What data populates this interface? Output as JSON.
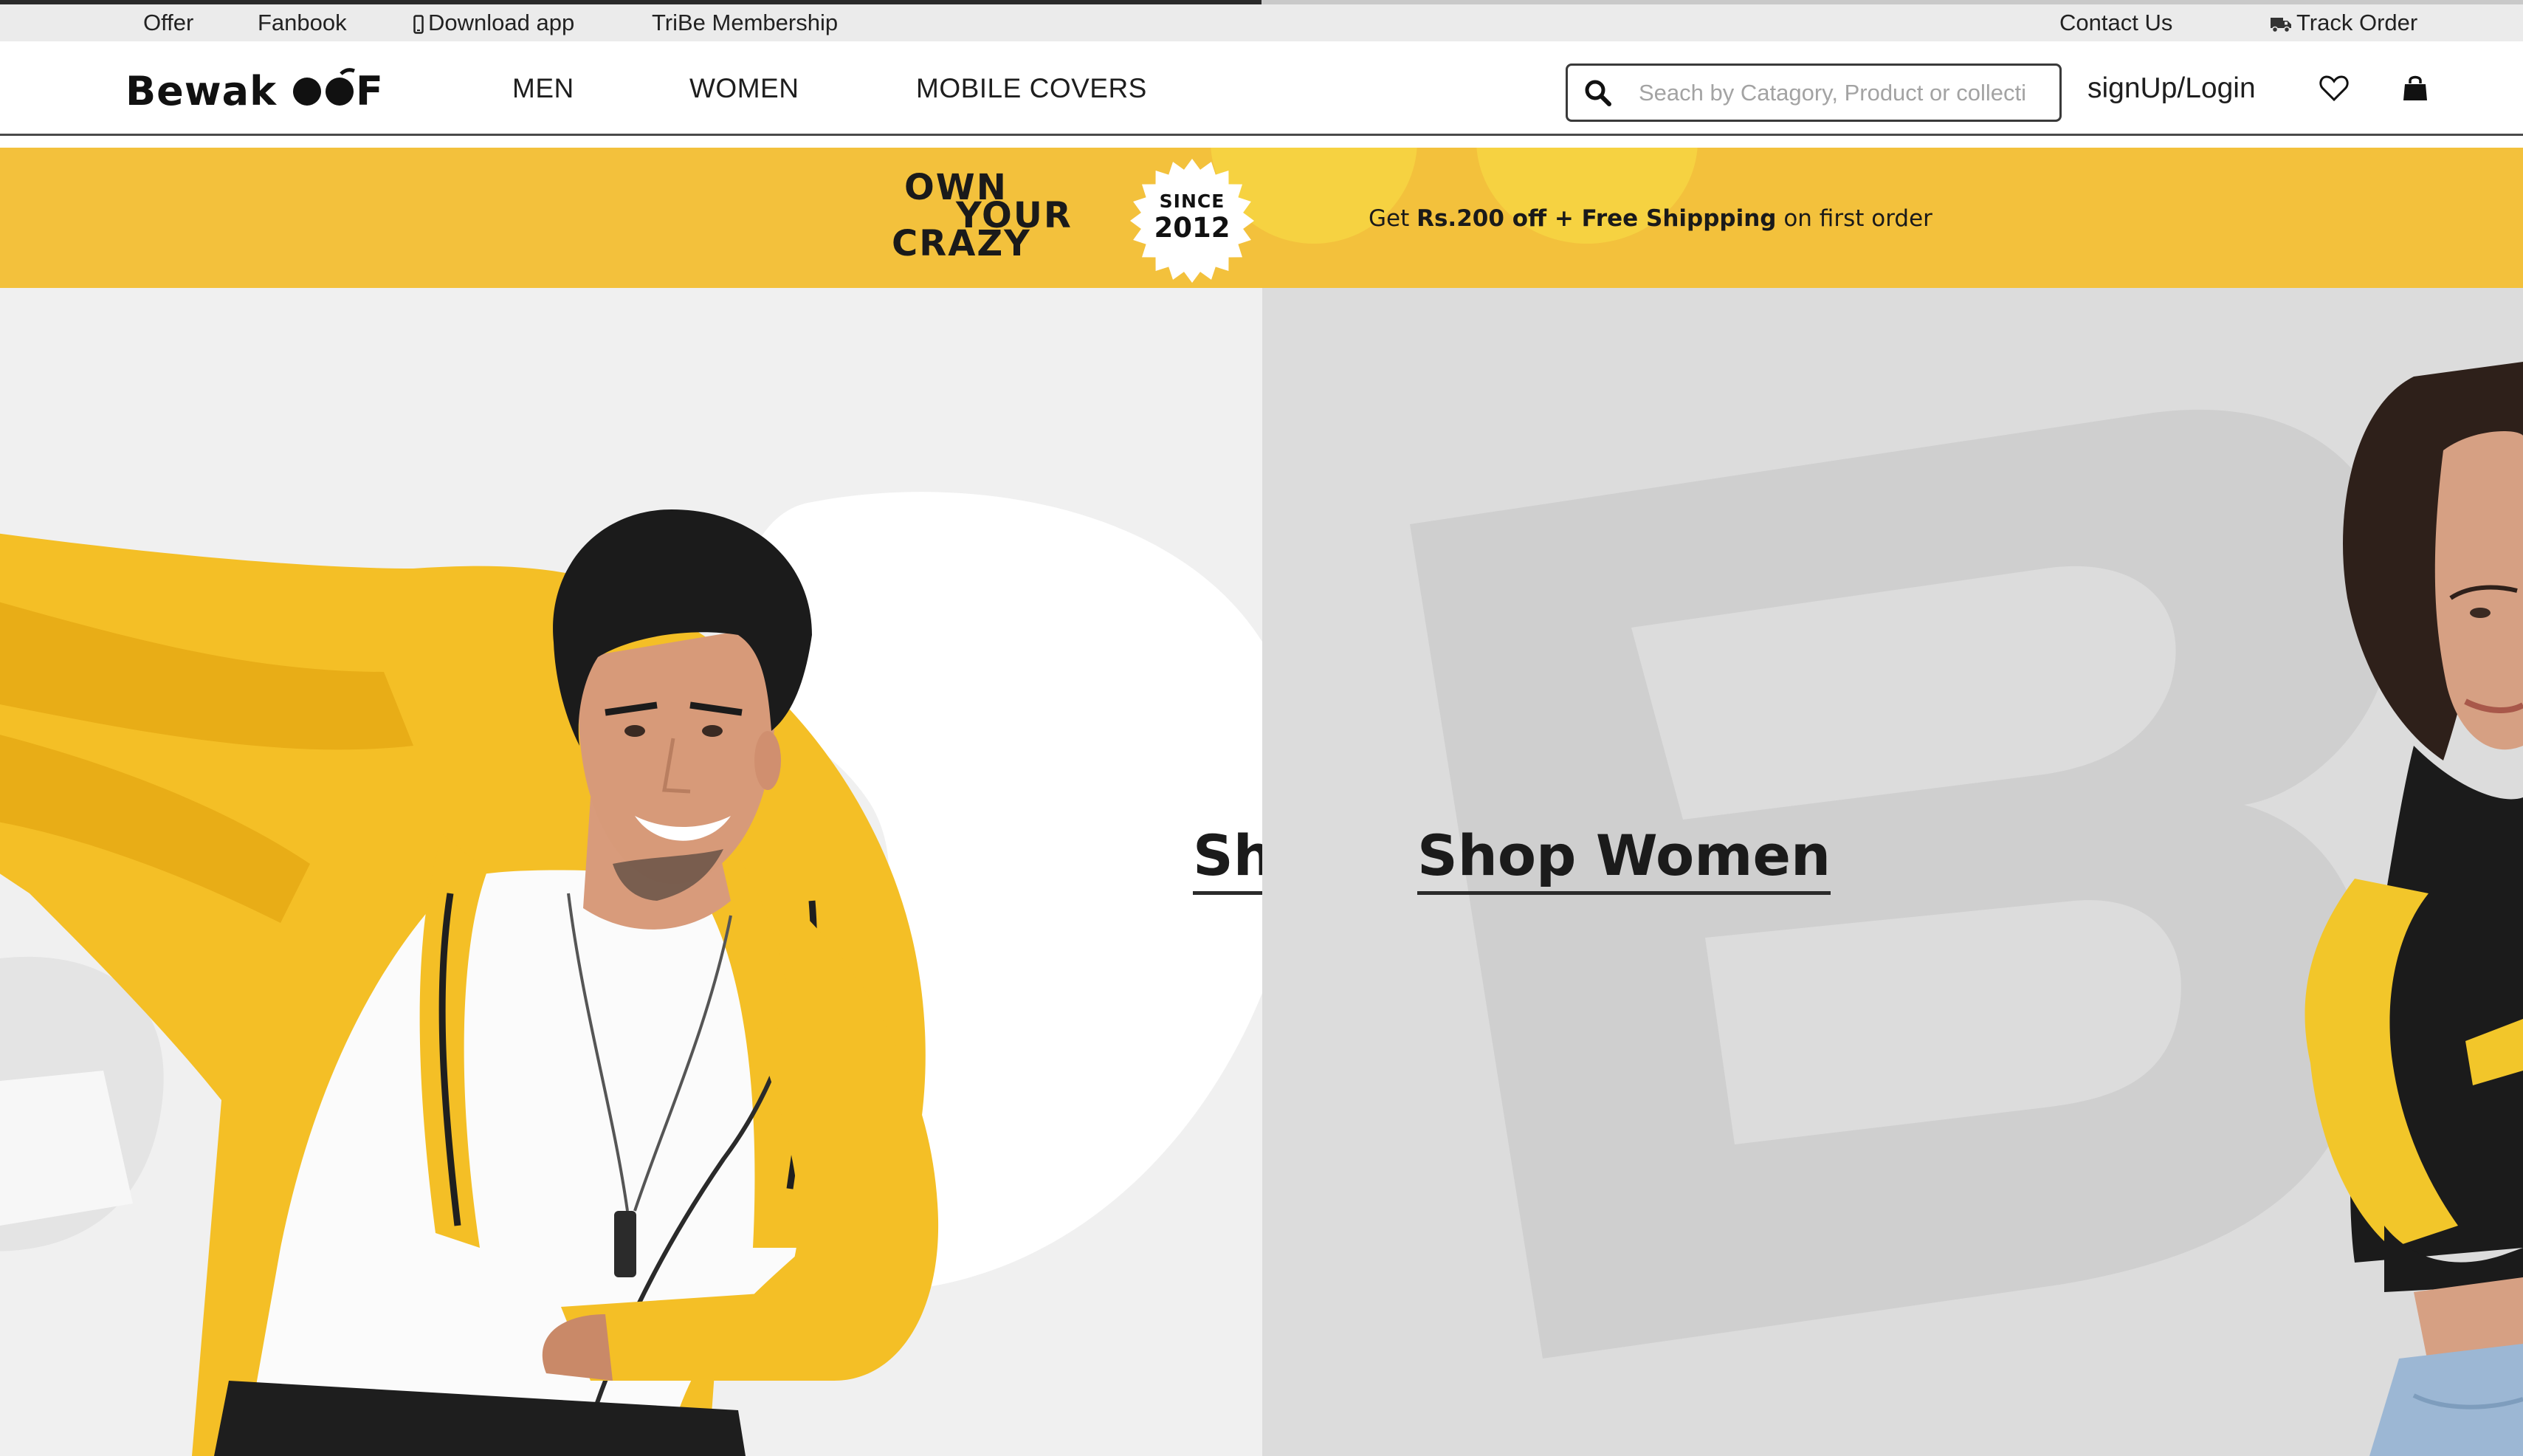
{
  "loading": {
    "progress": 0.5
  },
  "utility_bar": {
    "left": [
      {
        "label": "Offer"
      },
      {
        "label": "Fanbook"
      },
      {
        "label": "Download app",
        "icon": "mobile-phone-icon"
      },
      {
        "label": "TriBe Membership"
      }
    ],
    "right": [
      {
        "label": "Contact Us"
      },
      {
        "label": "Track Order",
        "icon": "truck-icon"
      }
    ]
  },
  "header": {
    "logo_text": "Bewakoof",
    "nav": [
      {
        "label": "MEN"
      },
      {
        "label": "WOMEN"
      },
      {
        "label": "MOBILE COVERS"
      }
    ],
    "search": {
      "placeholder": "Seach by Catagory, Product or collecti",
      "value": "",
      "icon": "search-icon"
    },
    "login_label": "signUp/Login",
    "icons": [
      "heart-icon",
      "shopping-bag-icon"
    ]
  },
  "promo_banner": {
    "tagline_lines": [
      "OWN",
      "YOUR",
      "CRAZY"
    ],
    "badge_top": "SINCE",
    "badge_year": "2012",
    "offer_prefix": "Get ",
    "offer_bold": "Rs.200 off + Free Shippping",
    "offer_suffix": " on first order",
    "background_color": "#f3c13c"
  },
  "hero": {
    "men": {
      "link_label": "Shop Men",
      "visible_label": "Sh"
    },
    "women": {
      "link_label": "Shop Women"
    }
  },
  "colors": {
    "accent_yellow": "#f3c13c",
    "text_dark": "#1e1e1e"
  }
}
